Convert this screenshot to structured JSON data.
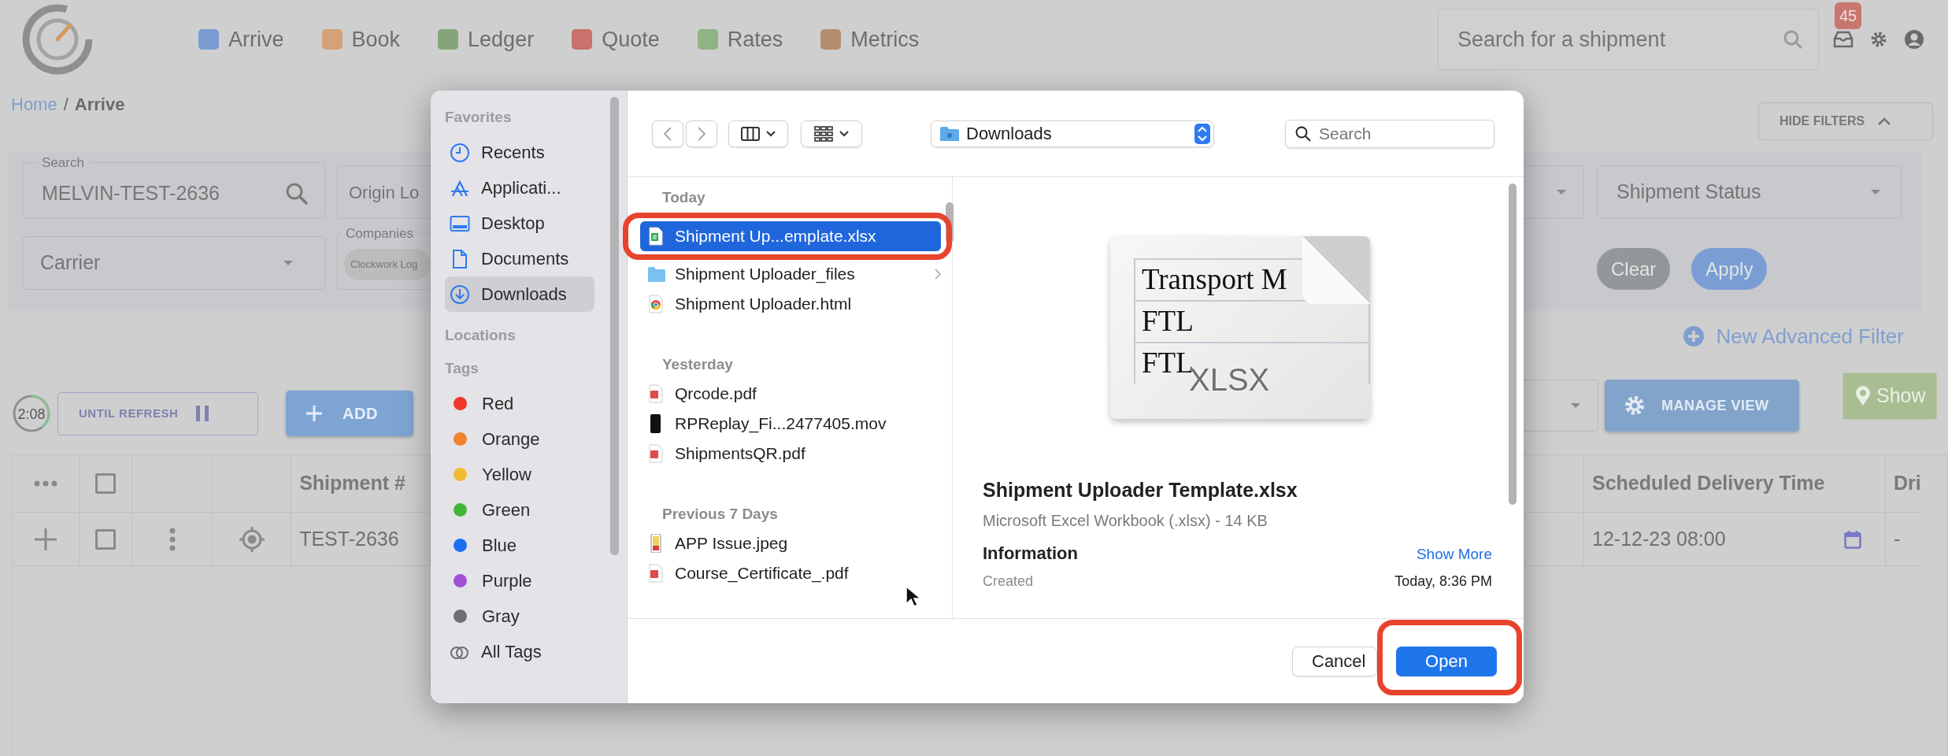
{
  "app": {
    "nav": [
      {
        "label": "Arrive",
        "color": "#7a9cd3"
      },
      {
        "label": "Book",
        "color": "#d4a276"
      },
      {
        "label": "Ledger",
        "color": "#84a579"
      },
      {
        "label": "Quote",
        "color": "#c9716a"
      },
      {
        "label": "Rates",
        "color": "#8fb382"
      },
      {
        "label": "Metrics",
        "color": "#b58d6f"
      }
    ],
    "search": {
      "placeholder": "Search for a shipment"
    },
    "notifications": {
      "count": "45"
    },
    "breadcrumb_separator": "/",
    "breadcrumbs": [
      {
        "label": "Home",
        "current": false
      },
      {
        "label": "Arrive",
        "current": true
      }
    ],
    "hide_filters": "HIDE FILTERS",
    "filters": {
      "search": {
        "label": "Search",
        "value": "MELVIN-TEST-2636"
      },
      "origin": {
        "placeholder": "Origin Lo"
      },
      "carrier": {
        "placeholder": "Carrier"
      },
      "companies": {
        "label": "Companies",
        "chips": [
          "Clockwork Log"
        ]
      },
      "shipment_status": {
        "placeholder": "Shipment Status"
      },
      "clear": "Clear",
      "apply": "Apply"
    },
    "new_filter": "New Advanced Filter",
    "toolbar": {
      "timer": {
        "text": "2:08",
        "level": 0.4
      },
      "refresh": "UNTIL REFRESH",
      "add": "ADD",
      "manage_view": "MANAGE VIEW",
      "show": "Show"
    },
    "table": {
      "columns": [
        {
          "kind": "more"
        },
        {
          "kind": "checkbox",
          "checked": false
        },
        {
          "kind": "blank"
        },
        {
          "kind": "blank"
        },
        {
          "kind": "text",
          "label": "Shipment #"
        },
        {
          "kind": "blank"
        },
        {
          "kind": "text",
          "label": "Scheduled Delivery Time"
        },
        {
          "kind": "text",
          "label": "Dri"
        }
      ],
      "rows": [
        {
          "cells": [
            {
              "kind": "add"
            },
            {
              "kind": "checkbox",
              "checked": false
            },
            {
              "kind": "menu"
            },
            {
              "kind": "locate"
            },
            {
              "kind": "text",
              "text": "TEST-2636"
            },
            {
              "kind": "blank"
            },
            {
              "kind": "date",
              "text": "12-12-23 08:00"
            },
            {
              "kind": "text",
              "text": "-"
            }
          ]
        }
      ]
    }
  },
  "dialog": {
    "sidebar": [
      {
        "title": "Favorites",
        "items": [
          {
            "kind": "recents",
            "label": "Recents",
            "selected": false
          },
          {
            "kind": "apps",
            "label": "Applicati...",
            "selected": false
          },
          {
            "kind": "desktop",
            "label": "Desktop",
            "selected": false
          },
          {
            "kind": "documents",
            "label": "Documents",
            "selected": false
          },
          {
            "kind": "downloads",
            "label": "Downloads",
            "selected": true
          }
        ]
      },
      {
        "title": "Locations"
      },
      {
        "title": "Tags",
        "items": [
          {
            "kind": "tag",
            "label": "Red",
            "color": "#f2352a",
            "selected": false
          },
          {
            "kind": "tag",
            "label": "Orange",
            "color": "#f0832e",
            "selected": false
          },
          {
            "kind": "tag",
            "label": "Yellow",
            "color": "#f1bc33",
            "selected": false
          },
          {
            "kind": "tag",
            "label": "Green",
            "color": "#42b638",
            "selected": false
          },
          {
            "kind": "tag",
            "label": "Blue",
            "color": "#1c6ef2",
            "selected": false
          },
          {
            "kind": "tag",
            "label": "Purple",
            "color": "#a04fd6",
            "selected": false
          },
          {
            "kind": "tag",
            "label": "Gray",
            "color": "#6e6e73",
            "selected": false
          },
          {
            "kind": "all-tags",
            "label": "All Tags",
            "selected": false
          }
        ]
      }
    ],
    "location": "Downloads",
    "search": {
      "placeholder": "Search"
    },
    "groups": [
      {
        "title": "Today",
        "files": [
          {
            "kind": "xlsx",
            "name": "Shipment Up...emplate.xlsx",
            "selected": true,
            "annotated": true
          },
          {
            "kind": "folder",
            "name": "Shipment Uploader_files",
            "selected": false,
            "annotated": false
          },
          {
            "kind": "html",
            "name": "Shipment Uploader.html",
            "selected": false,
            "annotated": false
          }
        ]
      },
      {
        "title": "Yesterday",
        "files": [
          {
            "kind": "pdf",
            "name": "Qrcode.pdf",
            "selected": false,
            "annotated": false
          },
          {
            "kind": "mov",
            "name": "RPReplay_Fi...2477405.mov",
            "selected": false,
            "annotated": false
          },
          {
            "kind": "pdf",
            "name": "ShipmentsQR.pdf",
            "selected": false,
            "annotated": false
          }
        ]
      },
      {
        "title": "Previous 7 Days",
        "files": [
          {
            "kind": "jpeg",
            "name": "APP Issue.jpeg",
            "selected": false,
            "annotated": false
          },
          {
            "kind": "pdf",
            "name": "Course_Certificate_.pdf",
            "selected": false,
            "annotated": false
          }
        ]
      }
    ],
    "preview": {
      "lines": [
        "Transport M",
        "FTL",
        "FTL"
      ],
      "badge": "XLSX",
      "name": "Shipment Uploader Template.xlsx",
      "type_size": "Microsoft Excel Workbook (.xlsx) - 14 KB",
      "info_title": "Information",
      "show_more": "Show More",
      "created_label": "Created",
      "created_value": "Today, 8:36 PM"
    },
    "buttons": [
      {
        "label": "Cancel",
        "primary": false,
        "annotated": false
      },
      {
        "label": "Open",
        "primary": true,
        "annotated": true
      }
    ]
  }
}
